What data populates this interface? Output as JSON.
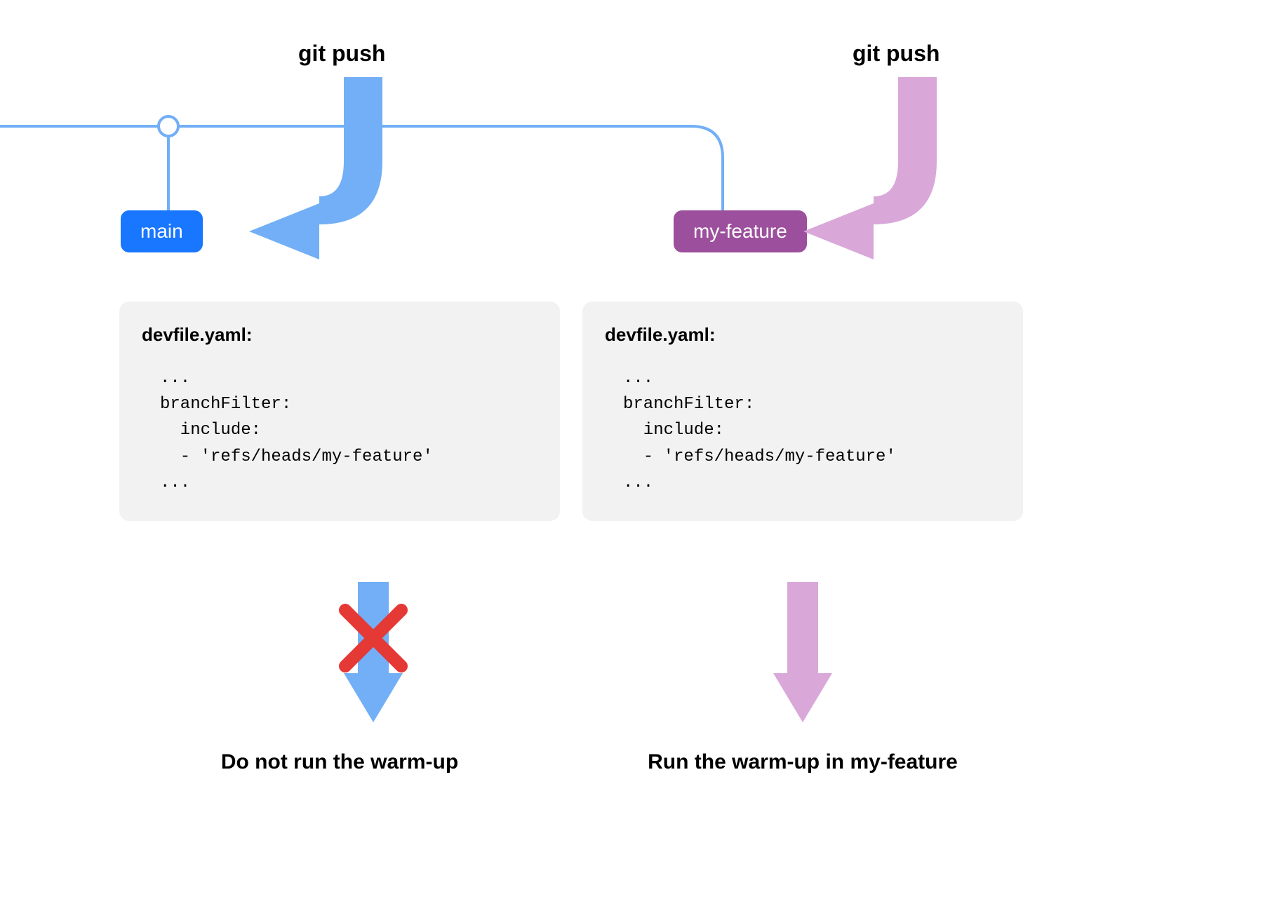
{
  "labels": {
    "gitpush_left": "git push",
    "gitpush_right": "git push"
  },
  "branches": {
    "main": "main",
    "feature": "my-feature"
  },
  "colors": {
    "blue_branch": "#1976ff",
    "blue_arrow": "#72aff6",
    "purple_branch": "#9c4f9c",
    "purple_arrow": "#d9a8d9",
    "cross": "#e53935"
  },
  "code": {
    "filename": "devfile.yaml:",
    "snippet": "...\nbranchFilter:\n  include:\n  - 'refs/heads/my-feature'\n..."
  },
  "results": {
    "left": "Do not run the warm-up",
    "right": "Run the warm-up in my-feature"
  }
}
